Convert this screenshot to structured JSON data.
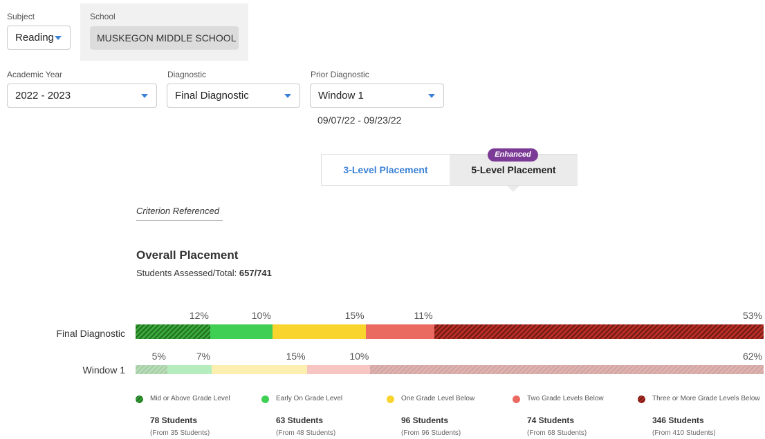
{
  "filters": {
    "subject": {
      "label": "Subject",
      "value": "Reading"
    },
    "school": {
      "label": "School",
      "value": "MUSKEGON MIDDLE SCHOOL"
    },
    "academic_year": {
      "label": "Academic Year",
      "value": "2022 - 2023"
    },
    "diagnostic": {
      "label": "Diagnostic",
      "value": "Final Diagnostic"
    },
    "prior_diagnostic": {
      "label": "Prior Diagnostic",
      "value": "Window 1"
    },
    "date_range": "09/07/22 - 09/23/22"
  },
  "placement_toggle": {
    "left": "3-Level Placement",
    "right": "5-Level Placement",
    "badge": "Enhanced",
    "active": "right"
  },
  "criterion_tab": "Criterion Referenced",
  "overall": {
    "title": "Overall Placement",
    "assessed_label": "Students Assessed/Total:",
    "assessed_value": "657/741"
  },
  "colors": {
    "mid_above": "#3aa83a",
    "early_on": "#3ecf54",
    "one_below": "#f8d42c",
    "two_below": "#ea6a62",
    "three_below": "#b82e26"
  },
  "chart_data": {
    "type": "bar",
    "stacked": true,
    "orientation": "horizontal",
    "categories": [
      "Final Diagnostic",
      "Window 1"
    ],
    "series": [
      {
        "name": "Mid or Above Grade Level",
        "values": [
          12,
          5
        ]
      },
      {
        "name": "Early On Grade Level",
        "values": [
          10,
          7
        ]
      },
      {
        "name": "One Grade Level Below",
        "values": [
          15,
          15
        ]
      },
      {
        "name": "Two Grade Levels Below",
        "values": [
          11,
          10
        ]
      },
      {
        "name": "Three or More Grade Levels Below",
        "values": [
          53,
          62
        ]
      }
    ],
    "labels": [
      [
        "12%",
        "10%",
        "15%",
        "11%",
        "53%"
      ],
      [
        "5%",
        "7%",
        "15%",
        "10%",
        "62%"
      ]
    ]
  },
  "legend": [
    {
      "label": "Mid or Above Grade Level",
      "count": "78 Students",
      "from": "(From 35 Students)"
    },
    {
      "label": "Early On Grade Level",
      "count": "63 Students",
      "from": "(From 48 Students)"
    },
    {
      "label": "One Grade Level Below",
      "count": "96 Students",
      "from": "(From 96 Students)"
    },
    {
      "label": "Two Grade Levels Below",
      "count": "74 Students",
      "from": "(From 68 Students)"
    },
    {
      "label": "Three or More Grade Levels Below",
      "count": "346 Students",
      "from": "(From 410 Students)"
    }
  ]
}
